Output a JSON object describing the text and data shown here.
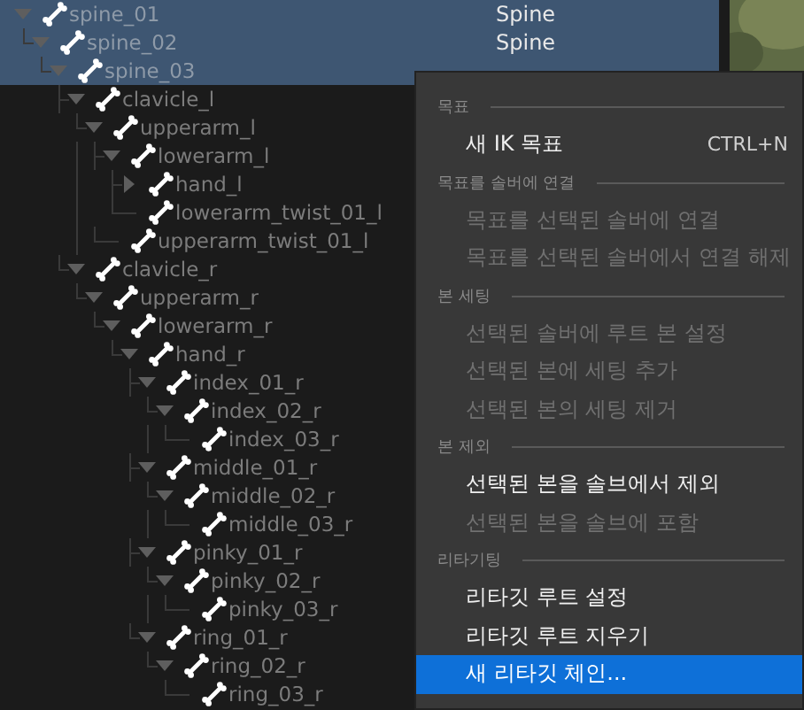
{
  "tree": [
    {
      "name": "spine_01",
      "type": "Spine",
      "selected": true,
      "expanded": true,
      "children": [
        {
          "name": "spine_02",
          "type": "Spine",
          "selected": true,
          "expanded": true,
          "children": [
            {
              "name": "spine_03",
              "selected": true,
              "expanded": true,
              "children": [
                {
                  "name": "clavicle_l",
                  "selected": false,
                  "expanded": true,
                  "children": [
                    {
                      "name": "upperarm_l",
                      "selected": false,
                      "expanded": true,
                      "children": [
                        {
                          "name": "lowerarm_l",
                          "selected": false,
                          "expanded": true,
                          "children": [
                            {
                              "name": "hand_l",
                              "selected": false,
                              "expanded": false
                            },
                            {
                              "name": "lowerarm_twist_01_l",
                              "selected": false
                            }
                          ]
                        },
                        {
                          "name": "upperarm_twist_01_l",
                          "selected": false
                        }
                      ]
                    }
                  ]
                },
                {
                  "name": "clavicle_r",
                  "selected": false,
                  "expanded": true,
                  "children": [
                    {
                      "name": "upperarm_r",
                      "selected": false,
                      "expanded": true,
                      "children": [
                        {
                          "name": "lowerarm_r",
                          "selected": false,
                          "expanded": true,
                          "children": [
                            {
                              "name": "hand_r",
                              "selected": false,
                              "expanded": true,
                              "children": [
                                {
                                  "name": "index_01_r",
                                  "selected": false,
                                  "expanded": true,
                                  "children": [
                                    {
                                      "name": "index_02_r",
                                      "selected": false,
                                      "expanded": true,
                                      "children": [
                                        {
                                          "name": "index_03_r",
                                          "selected": false
                                        }
                                      ]
                                    }
                                  ]
                                },
                                {
                                  "name": "middle_01_r",
                                  "selected": false,
                                  "expanded": true,
                                  "children": [
                                    {
                                      "name": "middle_02_r",
                                      "selected": false,
                                      "expanded": true,
                                      "children": [
                                        {
                                          "name": "middle_03_r",
                                          "selected": false
                                        }
                                      ]
                                    }
                                  ]
                                },
                                {
                                  "name": "pinky_01_r",
                                  "selected": false,
                                  "expanded": true,
                                  "children": [
                                    {
                                      "name": "pinky_02_r",
                                      "selected": false,
                                      "expanded": true,
                                      "children": [
                                        {
                                          "name": "pinky_03_r",
                                          "selected": false
                                        }
                                      ]
                                    }
                                  ]
                                },
                                {
                                  "name": "ring_01_r",
                                  "selected": false,
                                  "expanded": true,
                                  "children": [
                                    {
                                      "name": "ring_02_r",
                                      "selected": false,
                                      "expanded": true,
                                      "children": [
                                        {
                                          "name": "ring_03_r",
                                          "selected": false
                                        }
                                      ]
                                    }
                                  ]
                                }
                              ]
                            }
                          ]
                        }
                      ]
                    }
                  ]
                }
              ]
            }
          ]
        }
      ]
    }
  ],
  "context_menu": [
    {
      "kind": "header",
      "label": "목표"
    },
    {
      "kind": "item",
      "label": "새 IK 목표",
      "shortcut": "CTRL+N",
      "disabled": false,
      "selected": false
    },
    {
      "kind": "header",
      "label": "목표를 솔버에 연결"
    },
    {
      "kind": "item",
      "label": "목표를 선택된 솔버에 연결",
      "disabled": true,
      "selected": false
    },
    {
      "kind": "item",
      "label": "목표를 선택된 솔버에서 연결 해제",
      "disabled": true,
      "selected": false
    },
    {
      "kind": "header",
      "label": "본 세팅"
    },
    {
      "kind": "item",
      "label": "선택된 솔버에 루트 본 설정",
      "disabled": true,
      "selected": false
    },
    {
      "kind": "item",
      "label": "선택된 본에 세팅 추가",
      "disabled": true,
      "selected": false
    },
    {
      "kind": "item",
      "label": "선택된 본의 세팅 제거",
      "disabled": true,
      "selected": false
    },
    {
      "kind": "header",
      "label": "본 제외"
    },
    {
      "kind": "item",
      "label": "선택된 본을 솔브에서 제외",
      "disabled": false,
      "selected": false
    },
    {
      "kind": "item",
      "label": "선택된 본을 솔브에 포함",
      "disabled": true,
      "selected": false
    },
    {
      "kind": "header",
      "label": "리타기팅"
    },
    {
      "kind": "item",
      "label": "리타깃 루트 설정",
      "disabled": false,
      "selected": false
    },
    {
      "kind": "item",
      "label": "리타깃 루트 지우기",
      "disabled": false,
      "selected": false
    },
    {
      "kind": "item",
      "label": "새 리타깃 체인...",
      "disabled": false,
      "selected": true
    }
  ]
}
